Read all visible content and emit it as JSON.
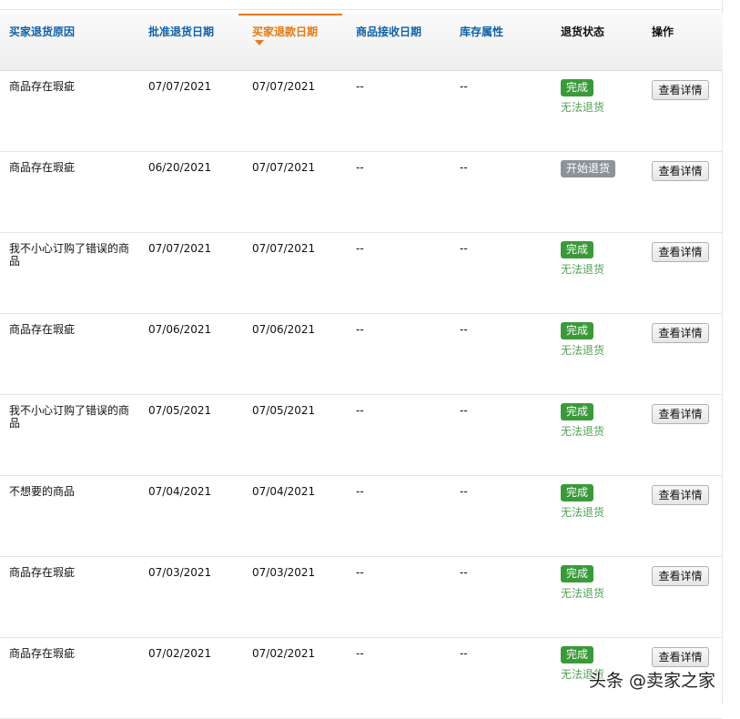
{
  "columns": {
    "reason": "买家退货原因",
    "approve_date": "批准退货日期",
    "refund_date": "买家退款日期",
    "receive_date": "商品接收日期",
    "stock_attr": "库存属性",
    "return_status": "退货状态",
    "action": "操作"
  },
  "sorted_column": "买家退款日期",
  "rows": [
    {
      "reason": "商品存在瑕疵",
      "approve_date": "07/07/2021",
      "refund_date": "07/07/2021",
      "receive_date": "--",
      "stock_attr": "--",
      "status": "完成",
      "status_note": "无法退货",
      "action": "查看详情"
    },
    {
      "reason": "商品存在瑕疵",
      "approve_date": "06/20/2021",
      "refund_date": "07/07/2021",
      "receive_date": "--",
      "stock_attr": "--",
      "status": "开始退货",
      "status_note": "",
      "action": "查看详情"
    },
    {
      "reason": "我不小心订购了错误的商品",
      "approve_date": "07/07/2021",
      "refund_date": "07/07/2021",
      "receive_date": "--",
      "stock_attr": "--",
      "status": "完成",
      "status_note": "无法退货",
      "action": "查看详情"
    },
    {
      "reason": "商品存在瑕疵",
      "approve_date": "07/06/2021",
      "refund_date": "07/06/2021",
      "receive_date": "--",
      "stock_attr": "--",
      "status": "完成",
      "status_note": "无法退货",
      "action": "查看详情"
    },
    {
      "reason": "我不小心订购了错误的商品",
      "approve_date": "07/05/2021",
      "refund_date": "07/05/2021",
      "receive_date": "--",
      "stock_attr": "--",
      "status": "完成",
      "status_note": "无法退货",
      "action": "查看详情"
    },
    {
      "reason": "不想要的商品",
      "approve_date": "07/04/2021",
      "refund_date": "07/04/2021",
      "receive_date": "--",
      "stock_attr": "--",
      "status": "完成",
      "status_note": "无法退货",
      "action": "查看详情"
    },
    {
      "reason": "商品存在瑕疵",
      "approve_date": "07/03/2021",
      "refund_date": "07/03/2021",
      "receive_date": "--",
      "stock_attr": "--",
      "status": "完成",
      "status_note": "无法退货",
      "action": "查看详情"
    },
    {
      "reason": "商品存在瑕疵",
      "approve_date": "07/02/2021",
      "refund_date": "07/02/2021",
      "receive_date": "--",
      "stock_attr": "--",
      "status": "完成",
      "status_note": "无法退货",
      "action": "查看详情"
    }
  ],
  "colors": {
    "link": "#0f61a8",
    "sort_active": "#e47911",
    "badge_done": "#3a9a3a",
    "badge_start": "#8a9499",
    "status_note": "#55a055"
  },
  "watermark": "头条 @卖家之家"
}
